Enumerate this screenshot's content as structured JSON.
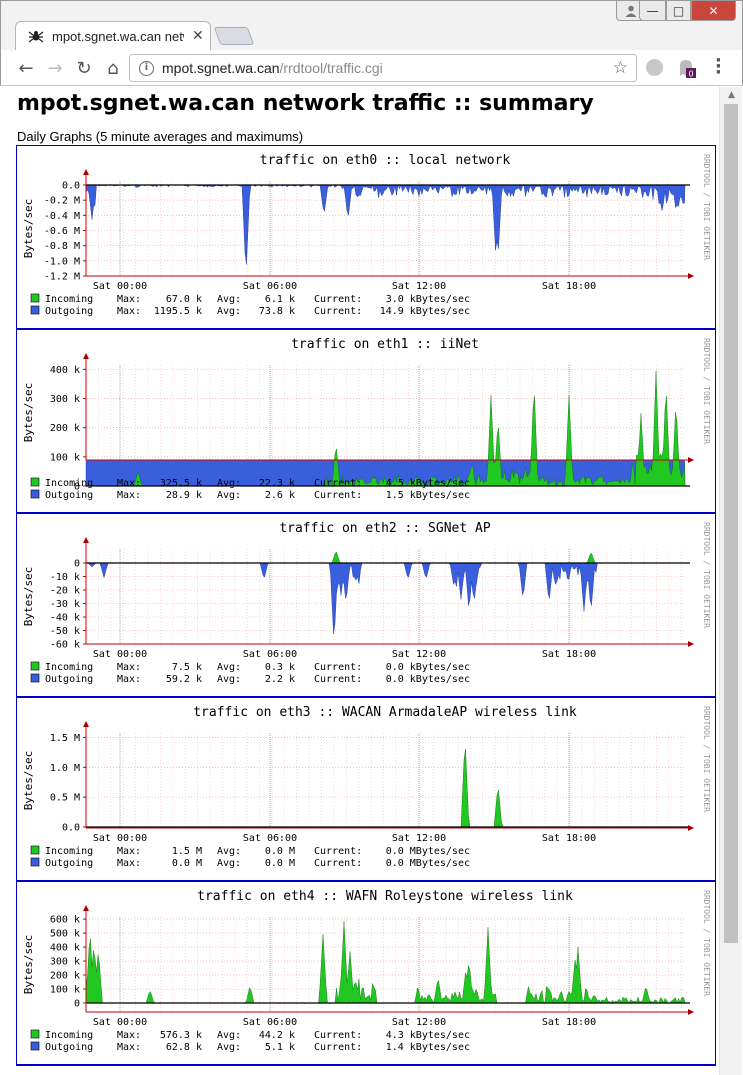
{
  "browser": {
    "tab_title": "mpot.sgnet.wa.can network traffic :: summary",
    "url_host": "mpot.sgnet.wa.can",
    "url_path": "/rrdtool/traffic.cgi",
    "extension_badge": "0"
  },
  "page": {
    "title": "mpot.sgnet.wa.can network traffic :: summary",
    "subtitle": "Daily Graphs (5 minute averages and maximums)"
  },
  "colors": {
    "incoming": "#22c822",
    "outgoing": "#3a5fdc",
    "grid": "#f0b0b0",
    "border": "#0000c8"
  },
  "graphs": [
    {
      "title": "traffic on eth0 :: local network",
      "ylabel": "Bytes/sec",
      "side_text": "RRDTOOL / TOBI OETIKER",
      "x_ticks": [
        "Sat 00:00",
        "Sat 06:00",
        "Sat 12:00",
        "Sat 18:00"
      ],
      "y_ticks": [
        "0.0",
        "-0.2 M",
        "-0.4 M",
        "-0.6 M",
        "-0.8 M",
        "-1.0 M",
        "-1.2 M"
      ],
      "incoming": {
        "label": "Incoming",
        "max": "67.0 k",
        "avg": "6.1 k",
        "current": "3.0 kBytes/sec"
      },
      "outgoing": {
        "label": "Outgoing",
        "max": "1195.5 k",
        "avg": "73.8 k",
        "current": "14.9 kBytes/sec"
      },
      "chart_data": {
        "type": "area",
        "ylim": [
          -1.2,
          0.05
        ],
        "unit": "M",
        "in_peaks": [
          0.067
        ],
        "out_peaks": [
          -1.1955
        ]
      }
    },
    {
      "title": "traffic on eth1 :: iiNet",
      "ylabel": "Bytes/sec",
      "side_text": "RRDTOOL / TOBI OETIKER",
      "x_ticks": [
        "Sat 00:00",
        "Sat 06:00",
        "Sat 12:00",
        "Sat 18:00"
      ],
      "y_ticks": [
        "400 k",
        "300 k",
        "200 k",
        "100 k",
        "0"
      ],
      "incoming": {
        "label": "Incoming",
        "max": "325.5 k",
        "avg": "22.3 k",
        "current": "4.5 kBytes/sec"
      },
      "outgoing": {
        "label": "Outgoing",
        "max": "28.9 k",
        "avg": "2.6 k",
        "current": "1.5 kBytes/sec"
      },
      "chart_data": {
        "type": "area",
        "ylim": [
          -30,
          420
        ],
        "unit": "k",
        "in_peaks": [
          325.5
        ],
        "out_peaks": [
          -28.9
        ]
      }
    },
    {
      "title": "traffic on eth2 :: SGNet AP",
      "ylabel": "Bytes/sec",
      "side_text": "RRDTOOL / TOBI OETIKER",
      "x_ticks": [
        "Sat 00:00",
        "Sat 06:00",
        "Sat 12:00",
        "Sat 18:00"
      ],
      "y_ticks": [
        "0",
        "-10 k",
        "-20 k",
        "-30 k",
        "-40 k",
        "-50 k",
        "-60 k"
      ],
      "incoming": {
        "label": "Incoming",
        "max": "7.5 k",
        "avg": "0.3 k",
        "current": "0.0 kBytes/sec"
      },
      "outgoing": {
        "label": "Outgoing",
        "max": "59.2 k",
        "avg": "2.2 k",
        "current": "0.0 kBytes/sec"
      },
      "chart_data": {
        "type": "area",
        "ylim": [
          -60,
          8
        ],
        "unit": "k",
        "in_peaks": [
          7.5
        ],
        "out_peaks": [
          -59.2
        ]
      }
    },
    {
      "title": "traffic on eth3 :: WACAN ArmadaleAP wireless link",
      "ylabel": "Bytes/sec",
      "side_text": "RRDTOOL / TOBI OETIKER",
      "x_ticks": [
        "Sat 00:00",
        "Sat 06:00",
        "Sat 12:00",
        "Sat 18:00"
      ],
      "y_ticks": [
        "1.5 M",
        "1.0 M",
        "0.5 M",
        "0.0"
      ],
      "incoming": {
        "label": "Incoming",
        "max": "1.5 M",
        "avg": "0.0 M",
        "current": "0.0 MBytes/sec"
      },
      "outgoing": {
        "label": "Outgoing",
        "max": "0.0 M",
        "avg": "0.0 M",
        "current": "0.0 MBytes/sec"
      },
      "chart_data": {
        "type": "area",
        "ylim": [
          0,
          1.6
        ],
        "unit": "M",
        "in_peaks": [
          1.5
        ],
        "out_peaks": [
          0.0
        ]
      }
    },
    {
      "title": "traffic on eth4 :: WAFN Roleystone wireless link",
      "ylabel": "Bytes/sec",
      "side_text": "RRDTOOL / TOBI OETIKER",
      "x_ticks": [
        "Sat 00:00",
        "Sat 06:00",
        "Sat 12:00",
        "Sat 18:00"
      ],
      "y_ticks": [
        "600 k",
        "500 k",
        "400 k",
        "300 k",
        "200 k",
        "100 k",
        "0"
      ],
      "incoming": {
        "label": "Incoming",
        "max": "576.3 k",
        "avg": "44.2 k",
        "current": "4.3 kBytes/sec"
      },
      "outgoing": {
        "label": "Outgoing",
        "max": "62.8 k",
        "avg": "5.1 k",
        "current": "1.4 kBytes/sec"
      },
      "chart_data": {
        "type": "area",
        "ylim": [
          -60,
          620
        ],
        "unit": "k",
        "in_peaks": [
          576.3
        ],
        "out_peaks": [
          -62.8
        ]
      }
    }
  ]
}
